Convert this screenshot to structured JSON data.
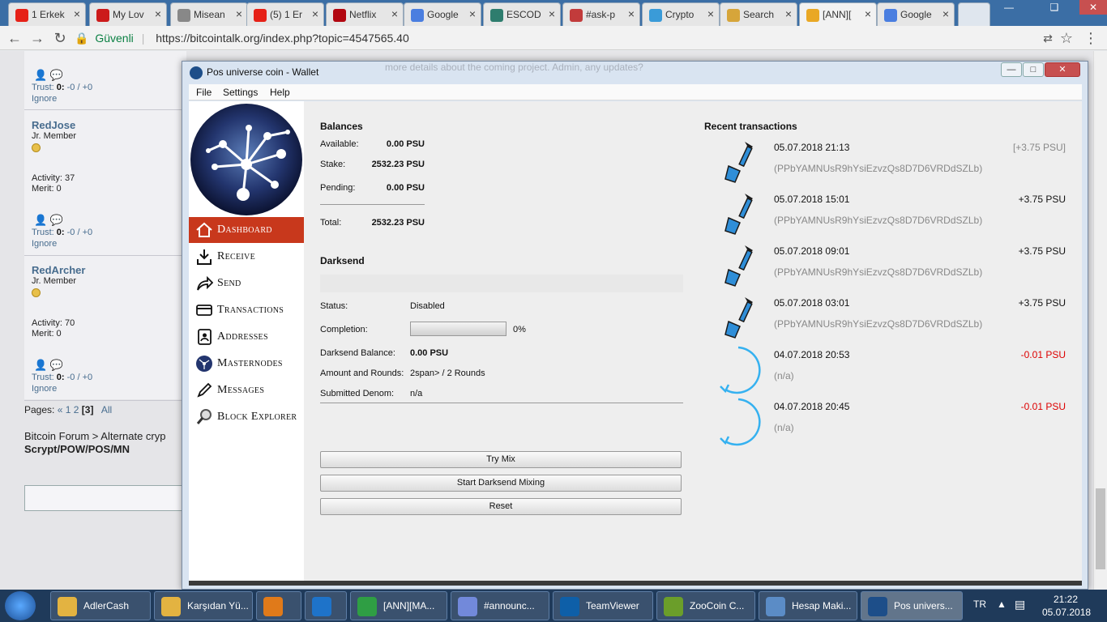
{
  "browser": {
    "tabs": [
      {
        "title": "1 Erkek",
        "color": "#e62117"
      },
      {
        "title": "My Lov",
        "color": "#cc1a1a"
      },
      {
        "title": "Misean",
        "color": "#888888"
      },
      {
        "title": "(5) 1 Er",
        "color": "#e62117"
      },
      {
        "title": "Netflix",
        "color": "#b20710"
      },
      {
        "title": "Google",
        "color": "#4a7ee0"
      },
      {
        "title": "ESCOD",
        "color": "#2e7d6e"
      },
      {
        "title": "#ask-p",
        "color": "#c23b3b"
      },
      {
        "title": "Crypto",
        "color": "#3a9bd8"
      },
      {
        "title": "Search",
        "color": "#d6a53a"
      },
      {
        "title": "[ANN][",
        "color": "#e9a825"
      },
      {
        "title": "Google",
        "color": "#4a7ee0"
      }
    ],
    "secure_label": "Güvenli",
    "url_host": "https://bitcointalk.org",
    "url_rest": "/index.php?topic=4547565.40"
  },
  "forum": {
    "users": [
      {
        "name": "",
        "rank": "",
        "activity": "",
        "merit": "",
        "trust_label": "Trust:",
        "trust_value": "0:",
        "trust_rest": " -0 / +0",
        "ignore": "Ignore"
      },
      {
        "name": "RedJose",
        "rank": "Jr. Member",
        "activity": "Activity: 37",
        "merit": "Merit: 0",
        "trust_label": "Trust:",
        "trust_value": "0:",
        "trust_rest": " -0 / +0",
        "ignore": "Ignore"
      },
      {
        "name": "RedArcher",
        "rank": "Jr. Member",
        "activity": "Activity: 70",
        "merit": "Merit: 0",
        "trust_label": "Trust:",
        "trust_value": "0:",
        "trust_rest": " -0 / +0",
        "ignore": "Ignore"
      }
    ],
    "pages_label": "Pages:",
    "pages_prev": "«",
    "page1": "1",
    "page2": "2",
    "page_current": "[3]",
    "pages_all": "All",
    "breadcrumb": "Bitcoin Forum > Alternate cryp",
    "breadcrumb2": "Scrypt/POW/POS/MN",
    "post_fragment": "more details about the coming project. Admin, any updates?"
  },
  "wallet": {
    "title": "Pos universe coin - Wallet",
    "menu": [
      "File",
      "Settings",
      "Help"
    ],
    "nav": [
      {
        "label": "Dashboard",
        "icon": "home-icon"
      },
      {
        "label": "Receive",
        "icon": "receive-icon"
      },
      {
        "label": "Send",
        "icon": "send-icon"
      },
      {
        "label": "Transactions",
        "icon": "transactions-icon"
      },
      {
        "label": "Addresses",
        "icon": "addresses-icon"
      },
      {
        "label": "Masternodes",
        "icon": "masternodes-icon"
      },
      {
        "label": "Messages",
        "icon": "messages-icon"
      },
      {
        "label": "Block Explorer",
        "icon": "block-explorer-icon"
      }
    ],
    "balances": {
      "title": "Balances",
      "available_label": "Available:",
      "available": "0.00 PSU",
      "stake_label": "Stake:",
      "stake": "2532.23 PSU",
      "pending_label": "Pending:",
      "pending": "0.00 PSU",
      "total_label": "Total:",
      "total": "2532.23 PSU"
    },
    "darksend": {
      "title": "Darksend",
      "status_label": "Status:",
      "status": "Disabled",
      "completion_label": "Completion:",
      "completion": "0%",
      "completion_fraction": 0,
      "balance_label": "Darksend Balance:",
      "balance": "0.00 PSU",
      "rounds_label": "Amount and Rounds:",
      "rounds": "2span> / 2 Rounds",
      "denom_label": "Submitted Denom:",
      "denom": "n/a",
      "try_mix": "Try Mix",
      "start_mixing": "Start Darksend Mixing",
      "reset": "Reset"
    },
    "recent": {
      "title": "Recent transactions",
      "items": [
        {
          "date": "05.07.2018 21:13",
          "amount": "[+3.75 PSU]",
          "address": "(PPbYAMNUsR9hYsiEzvzQs8D7D6VRDdSZLb)",
          "kind": "stake"
        },
        {
          "date": "05.07.2018 15:01",
          "amount": "+3.75 PSU",
          "address": "(PPbYAMNUsR9hYsiEzvzQs8D7D6VRDdSZLb)",
          "kind": "stake"
        },
        {
          "date": "05.07.2018 09:01",
          "amount": "+3.75 PSU",
          "address": "(PPbYAMNUsR9hYsiEzvzQs8D7D6VRDdSZLb)",
          "kind": "stake"
        },
        {
          "date": "05.07.2018 03:01",
          "amount": "+3.75 PSU",
          "address": "(PPbYAMNUsR9hYsiEzvzQs8D7D6VRDdSZLb)",
          "kind": "stake"
        },
        {
          "date": "04.07.2018 20:53",
          "amount": "-0.01 PSU",
          "address": "(n/a)",
          "kind": "self"
        },
        {
          "date": "04.07.2018 20:45",
          "amount": "-0.01 PSU",
          "address": "(n/a)",
          "kind": "self"
        }
      ]
    }
  },
  "taskbar": {
    "items": [
      {
        "label": "AdlerCash",
        "color": "#e3b341"
      },
      {
        "label": "Karşıdan Yü...",
        "color": "#e3b341"
      },
      {
        "label": "",
        "color": "#e07a1a"
      },
      {
        "label": "",
        "color": "#1e73c9"
      },
      {
        "label": "[ANN][MA...",
        "color": "#2f9e44"
      },
      {
        "label": "#⁣announc...",
        "color": "#7289da"
      },
      {
        "label": "TeamViewer",
        "color": "#0e5fa8"
      },
      {
        "label": "ZooCoin C...",
        "color": "#6b9e2a"
      },
      {
        "label": "Hesap Maki...",
        "color": "#5b8cc6"
      },
      {
        "label": "Pos univers...",
        "color": "#1d4e89"
      }
    ],
    "lang": "TR",
    "time": "21:22",
    "date": "05.07.2018"
  }
}
